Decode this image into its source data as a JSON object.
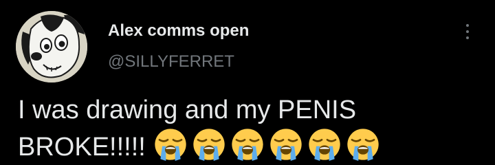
{
  "author": {
    "display_name": "Alex comms open",
    "handle": "@SILLYFERRET",
    "avatar_icon": "cartoon-dog-avatar"
  },
  "menu": {
    "icon": "more-vertical-icon"
  },
  "tweet": {
    "text": "I was drawing and my PENIS BROKE!!!!!",
    "emojis": [
      "loudly-crying-face",
      "loudly-crying-face",
      "loudly-crying-face",
      "loudly-crying-face",
      "loudly-crying-face",
      "loudly-crying-face"
    ]
  },
  "colors": {
    "background": "#000000",
    "text_primary": "#e7e9ea",
    "text_secondary": "#71767b",
    "emoji_face": "#ffcc4d",
    "emoji_tears": "#5dadec",
    "emoji_mouth": "#664500"
  }
}
